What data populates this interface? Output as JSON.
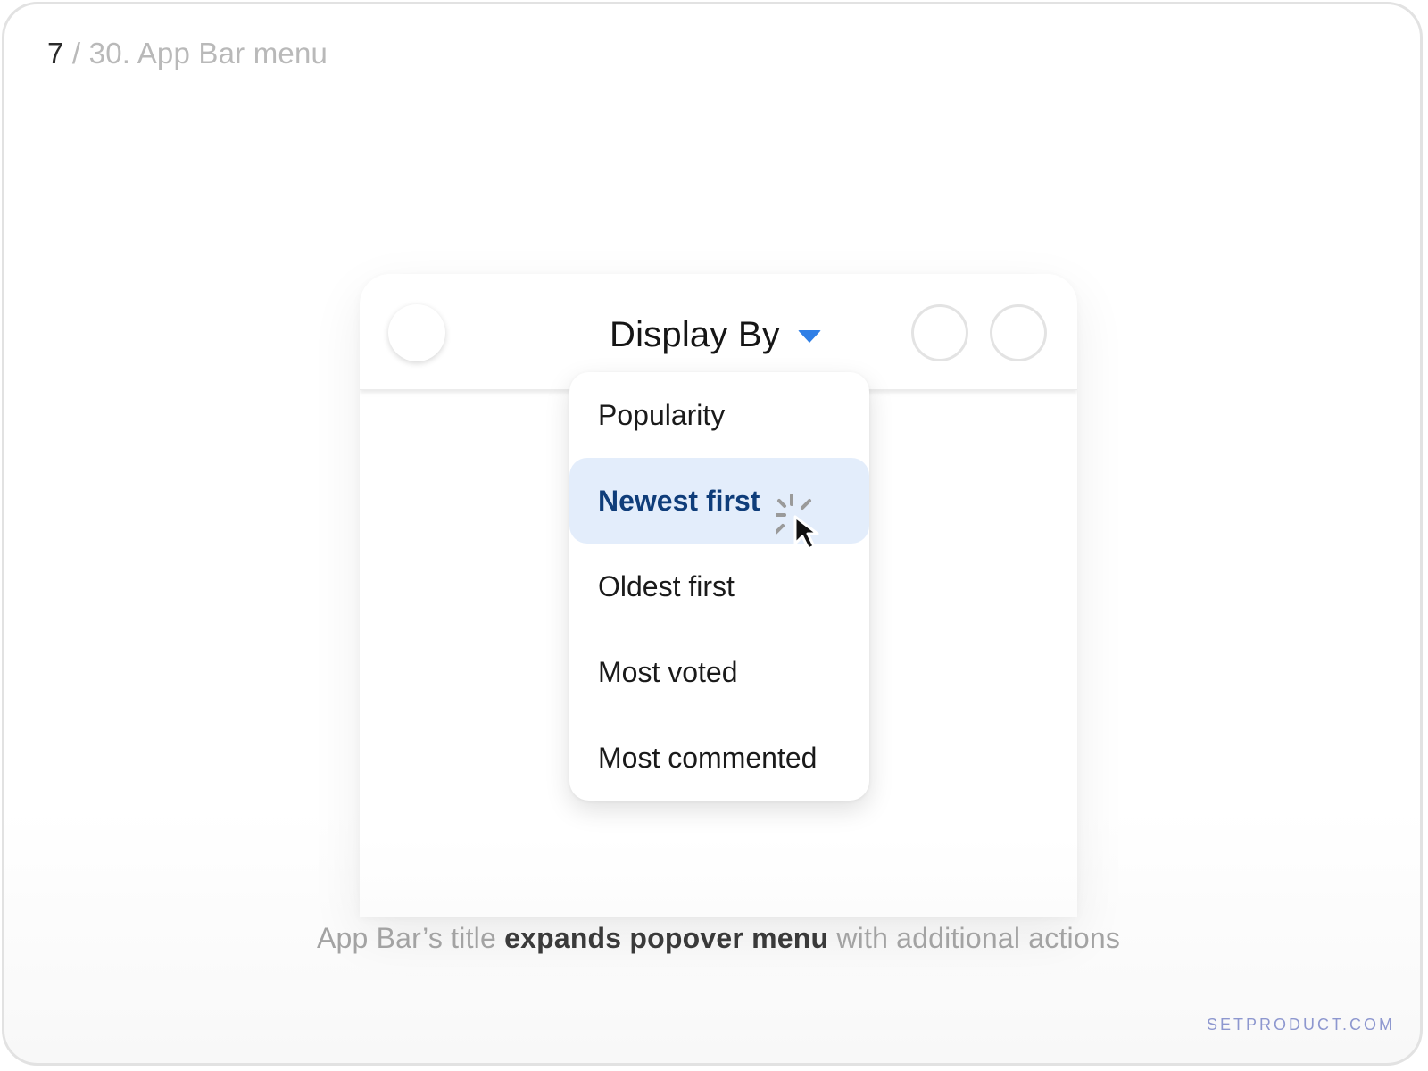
{
  "slide": {
    "current": "7",
    "rest": " / 30. App Bar menu"
  },
  "app_bar": {
    "title": "Display By",
    "caret_color": "#2f7fe6"
  },
  "menu": {
    "items": [
      {
        "label": "Popularity",
        "selected": false
      },
      {
        "label": "Newest first",
        "selected": true
      },
      {
        "label": "Oldest first",
        "selected": false
      },
      {
        "label": "Most voted",
        "selected": false
      },
      {
        "label": "Most commented",
        "selected": false
      }
    ],
    "selected_bg": "#e3edfb",
    "selected_text": "#0f3d7a"
  },
  "caption": {
    "part1": "App Bar’s title ",
    "part2": "expands popover menu",
    "part3": " with additional actions"
  },
  "brand": {
    "watermark": "SETPRODUCT.COM",
    "color": "#8d97cf"
  },
  "icons": {
    "caret": "caret-down-icon",
    "cursor": "pointer-cursor-icon"
  }
}
